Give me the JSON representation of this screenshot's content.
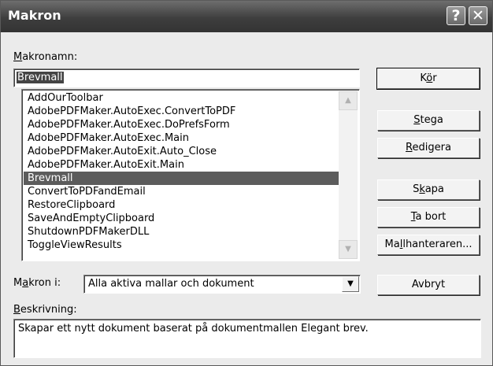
{
  "window": {
    "title": "Makron",
    "help_glyph": "?",
    "close_glyph": "✕"
  },
  "macro_name": {
    "label_accel": "M",
    "label_rest": "akronamn:",
    "value": "Brevmall"
  },
  "macro_list": {
    "items": [
      "AddOurToolbar",
      "AdobePDFMaker.AutoExec.ConvertToPDF",
      "AdobePDFMaker.AutoExec.DoPrefsForm",
      "AdobePDFMaker.AutoExec.Main",
      "AdobePDFMaker.AutoExit.Auto_Close",
      "AdobePDFMaker.AutoExit.Main",
      "Brevmall",
      "ConvertToPDFandEmail",
      "RestoreClipboard",
      "SaveAndEmptyClipboard",
      "ShutdownPDFMakerDLL",
      "ToggleViewResults"
    ],
    "selected_index": 6
  },
  "buttons": {
    "run": {
      "pre": "K",
      "accel": "ö",
      "post": "r"
    },
    "step": {
      "pre": "",
      "accel": "S",
      "post": "tega"
    },
    "edit": {
      "pre": "",
      "accel": "R",
      "post": "edigera"
    },
    "create": {
      "pre": "S",
      "accel": "k",
      "post": "apa"
    },
    "delete": {
      "pre": "",
      "accel": "T",
      "post": "a bort"
    },
    "organizer": {
      "pre": "Ma",
      "accel": "l",
      "post": "lhanteraren..."
    },
    "cancel": {
      "pre": "Avbryt",
      "accel": "",
      "post": ""
    }
  },
  "macros_in": {
    "label_pre": "M",
    "label_accel": "a",
    "label_post": "kron i:",
    "value": "Alla aktiva mallar och dokument"
  },
  "description": {
    "label_accel": "B",
    "label_rest": "eskrivning:",
    "text": "Skapar ett nytt dokument baserat på dokumentmallen Elegant brev."
  },
  "icons": {
    "scroll_up": "▲",
    "scroll_down": "▼",
    "dropdown": "▼"
  }
}
